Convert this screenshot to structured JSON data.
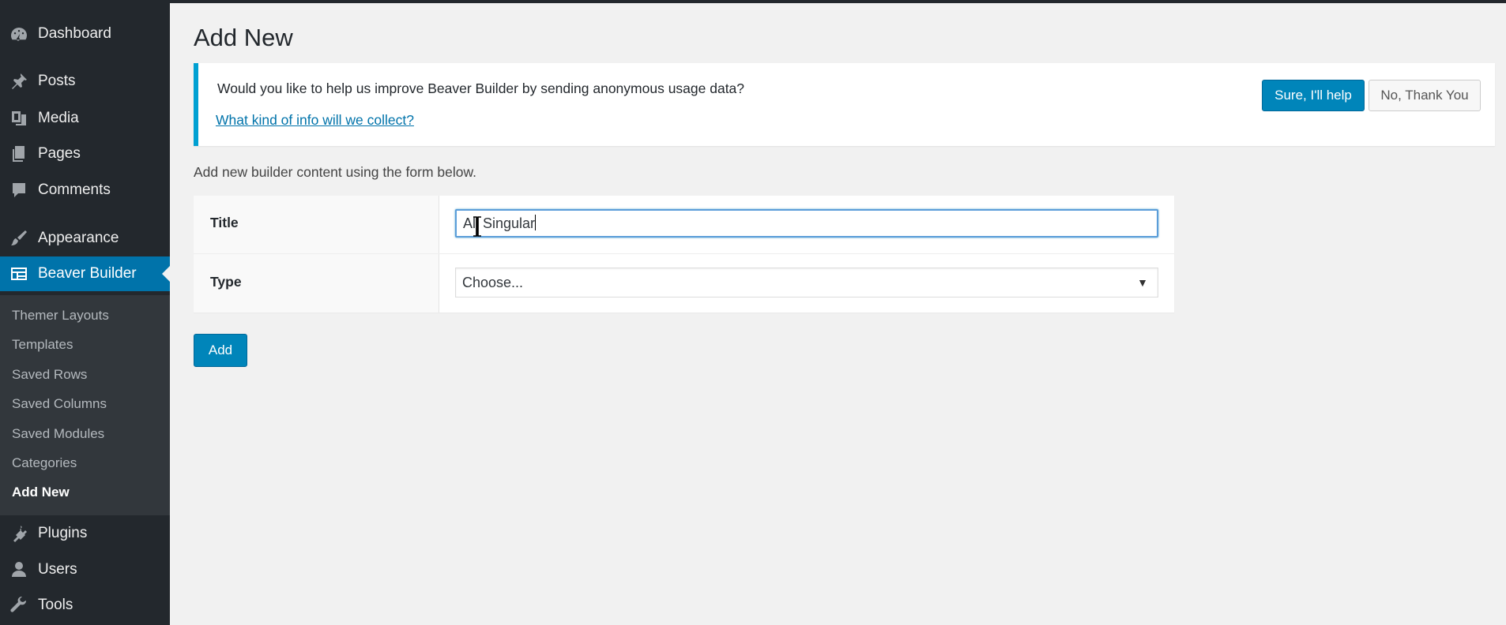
{
  "sidebar": {
    "items": [
      {
        "label": "Dashboard",
        "icon": "dashboard-icon"
      },
      {
        "label": "Posts",
        "icon": "pushpin-icon"
      },
      {
        "label": "Media",
        "icon": "media-icon"
      },
      {
        "label": "Pages",
        "icon": "pages-icon"
      },
      {
        "label": "Comments",
        "icon": "comment-icon"
      },
      {
        "label": "Appearance",
        "icon": "paintbrush-icon"
      },
      {
        "label": "Beaver Builder",
        "icon": "beaver-builder-icon"
      },
      {
        "label": "Plugins",
        "icon": "plugin-icon"
      },
      {
        "label": "Users",
        "icon": "user-icon"
      },
      {
        "label": "Tools",
        "icon": "wrench-icon"
      }
    ],
    "submenu": [
      "Themer Layouts",
      "Templates",
      "Saved Rows",
      "Saved Columns",
      "Saved Modules",
      "Categories",
      "Add New"
    ]
  },
  "main": {
    "page_title": "Add New",
    "notice": {
      "text": "Would you like to help us improve Beaver Builder by sending anonymous usage data?",
      "link": "What kind of info will we collect?",
      "accept_label": "Sure, I'll help",
      "decline_label": "No, Thank You"
    },
    "intro": "Add new builder content using the form below.",
    "form": {
      "title_label": "Title",
      "title_value": "All Singular",
      "type_label": "Type",
      "type_value": "Choose..."
    },
    "add_label": "Add"
  },
  "colors": {
    "sidebar_bg": "#23282d",
    "submenu_bg": "#32373c",
    "accent": "#0073aa",
    "primary_button": "#0085ba",
    "notice_border": "#00a0d2"
  }
}
